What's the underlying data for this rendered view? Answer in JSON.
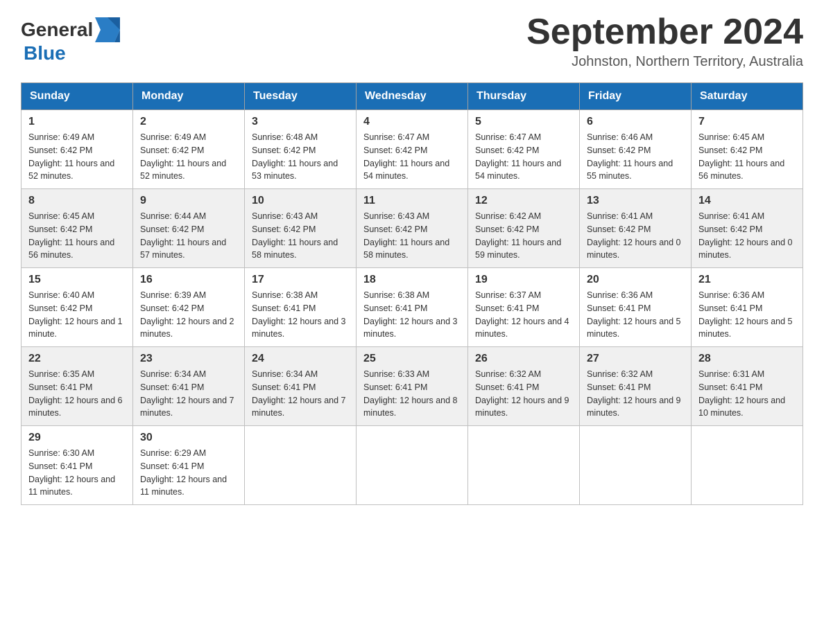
{
  "header": {
    "logo_general": "General",
    "logo_blue": "Blue",
    "month_title": "September 2024",
    "location": "Johnston, Northern Territory, Australia"
  },
  "weekdays": [
    "Sunday",
    "Monday",
    "Tuesday",
    "Wednesday",
    "Thursday",
    "Friday",
    "Saturday"
  ],
  "weeks": [
    [
      {
        "day": "1",
        "sunrise": "6:49 AM",
        "sunset": "6:42 PM",
        "daylight": "11 hours and 52 minutes."
      },
      {
        "day": "2",
        "sunrise": "6:49 AM",
        "sunset": "6:42 PM",
        "daylight": "11 hours and 52 minutes."
      },
      {
        "day": "3",
        "sunrise": "6:48 AM",
        "sunset": "6:42 PM",
        "daylight": "11 hours and 53 minutes."
      },
      {
        "day": "4",
        "sunrise": "6:47 AM",
        "sunset": "6:42 PM",
        "daylight": "11 hours and 54 minutes."
      },
      {
        "day": "5",
        "sunrise": "6:47 AM",
        "sunset": "6:42 PM",
        "daylight": "11 hours and 54 minutes."
      },
      {
        "day": "6",
        "sunrise": "6:46 AM",
        "sunset": "6:42 PM",
        "daylight": "11 hours and 55 minutes."
      },
      {
        "day": "7",
        "sunrise": "6:45 AM",
        "sunset": "6:42 PM",
        "daylight": "11 hours and 56 minutes."
      }
    ],
    [
      {
        "day": "8",
        "sunrise": "6:45 AM",
        "sunset": "6:42 PM",
        "daylight": "11 hours and 56 minutes."
      },
      {
        "day": "9",
        "sunrise": "6:44 AM",
        "sunset": "6:42 PM",
        "daylight": "11 hours and 57 minutes."
      },
      {
        "day": "10",
        "sunrise": "6:43 AM",
        "sunset": "6:42 PM",
        "daylight": "11 hours and 58 minutes."
      },
      {
        "day": "11",
        "sunrise": "6:43 AM",
        "sunset": "6:42 PM",
        "daylight": "11 hours and 58 minutes."
      },
      {
        "day": "12",
        "sunrise": "6:42 AM",
        "sunset": "6:42 PM",
        "daylight": "11 hours and 59 minutes."
      },
      {
        "day": "13",
        "sunrise": "6:41 AM",
        "sunset": "6:42 PM",
        "daylight": "12 hours and 0 minutes."
      },
      {
        "day": "14",
        "sunrise": "6:41 AM",
        "sunset": "6:42 PM",
        "daylight": "12 hours and 0 minutes."
      }
    ],
    [
      {
        "day": "15",
        "sunrise": "6:40 AM",
        "sunset": "6:42 PM",
        "daylight": "12 hours and 1 minute."
      },
      {
        "day": "16",
        "sunrise": "6:39 AM",
        "sunset": "6:42 PM",
        "daylight": "12 hours and 2 minutes."
      },
      {
        "day": "17",
        "sunrise": "6:38 AM",
        "sunset": "6:41 PM",
        "daylight": "12 hours and 3 minutes."
      },
      {
        "day": "18",
        "sunrise": "6:38 AM",
        "sunset": "6:41 PM",
        "daylight": "12 hours and 3 minutes."
      },
      {
        "day": "19",
        "sunrise": "6:37 AM",
        "sunset": "6:41 PM",
        "daylight": "12 hours and 4 minutes."
      },
      {
        "day": "20",
        "sunrise": "6:36 AM",
        "sunset": "6:41 PM",
        "daylight": "12 hours and 5 minutes."
      },
      {
        "day": "21",
        "sunrise": "6:36 AM",
        "sunset": "6:41 PM",
        "daylight": "12 hours and 5 minutes."
      }
    ],
    [
      {
        "day": "22",
        "sunrise": "6:35 AM",
        "sunset": "6:41 PM",
        "daylight": "12 hours and 6 minutes."
      },
      {
        "day": "23",
        "sunrise": "6:34 AM",
        "sunset": "6:41 PM",
        "daylight": "12 hours and 7 minutes."
      },
      {
        "day": "24",
        "sunrise": "6:34 AM",
        "sunset": "6:41 PM",
        "daylight": "12 hours and 7 minutes."
      },
      {
        "day": "25",
        "sunrise": "6:33 AM",
        "sunset": "6:41 PM",
        "daylight": "12 hours and 8 minutes."
      },
      {
        "day": "26",
        "sunrise": "6:32 AM",
        "sunset": "6:41 PM",
        "daylight": "12 hours and 9 minutes."
      },
      {
        "day": "27",
        "sunrise": "6:32 AM",
        "sunset": "6:41 PM",
        "daylight": "12 hours and 9 minutes."
      },
      {
        "day": "28",
        "sunrise": "6:31 AM",
        "sunset": "6:41 PM",
        "daylight": "12 hours and 10 minutes."
      }
    ],
    [
      {
        "day": "29",
        "sunrise": "6:30 AM",
        "sunset": "6:41 PM",
        "daylight": "12 hours and 11 minutes."
      },
      {
        "day": "30",
        "sunrise": "6:29 AM",
        "sunset": "6:41 PM",
        "daylight": "12 hours and 11 minutes."
      },
      null,
      null,
      null,
      null,
      null
    ]
  ],
  "labels": {
    "sunrise": "Sunrise:",
    "sunset": "Sunset:",
    "daylight": "Daylight:"
  }
}
